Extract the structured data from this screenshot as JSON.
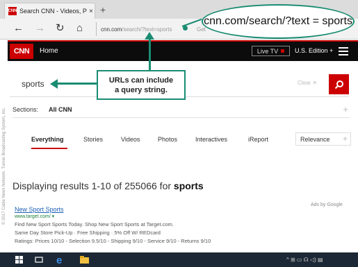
{
  "browser": {
    "tab_title": "Search CNN - Videos, P",
    "tab_favicon": "CNN",
    "tab_close": "×",
    "new_tab": "+",
    "back": "←",
    "forward": "→",
    "refresh": "↻",
    "home": "⌂",
    "address_host": "cnn.com",
    "address_path": "/search/?text=sports",
    "address_extra": "Get"
  },
  "callout_url": "cnn.com/search/?text = sports",
  "callout_note": {
    "line1": "URLs can include",
    "line2": "a query string."
  },
  "cnn_header": {
    "logo": "CNN",
    "home": "Home",
    "live_tv": "Live TV",
    "edition": "U.S. Edition +"
  },
  "search": {
    "value": "sports",
    "clear_label": "Clear ✕"
  },
  "sections": {
    "label": "Sections:",
    "value": "All CNN",
    "plus": "+"
  },
  "filters": {
    "items": [
      "Everything",
      "Stories",
      "Videos",
      "Photos",
      "Interactives",
      "iReport"
    ],
    "sort_label": "Relevance",
    "sort_plus": "+"
  },
  "results": {
    "prefix": "Displaying results 1-10 of 255066 for ",
    "query": "sports"
  },
  "ad": {
    "ads_by": "Ads by Google",
    "title": "New Sport Sports",
    "url": "www.target.com/ ▾",
    "line1": "Find New Sport Sports Today. Shop New Sport Sports at Target.com.",
    "line2": "Same Day Store Pick-Up · Free Shipping · 5% Off W/ REDcard",
    "line3": "Ratings: Prices 10/10 - Selection 9.5/10 - Shipping 9/10 - Service 9/10 - Returns 9/10"
  },
  "credit": "© 2017 Cable News Network. Turner Broadcasting System, Inc.",
  "taskbar": {
    "tray": "^ ⊞ ▭ ☊ ◁) ▤"
  },
  "colors": {
    "accent_teal": "#1a8c72",
    "cnn_red": "#cc0000"
  }
}
